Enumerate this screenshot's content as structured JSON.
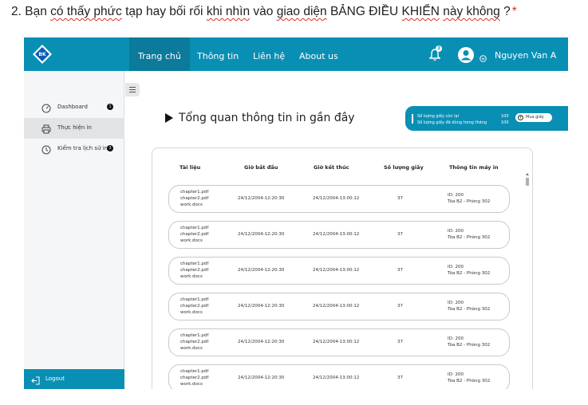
{
  "question": {
    "number": "2.",
    "text_a": "Bạn",
    "text_b": "có thấy phức",
    "text_c": "tạp hay bối rối",
    "text_d": "khi nhìn",
    "text_e": "vào",
    "text_f": "giao diện",
    "text_g": "BẢNG ĐIỀU",
    "text_h": "KHIỂN",
    "text_i": "này không",
    "text_j": "?",
    "required": "*"
  },
  "topbar": {
    "logo_text": "BK",
    "nav": [
      "Trang chủ",
      "Thông tin",
      "Liên hệ",
      "About us"
    ],
    "notification_count": "3",
    "username": "Nguyen Van A"
  },
  "sidebar": {
    "items": [
      {
        "label": "Dashboard",
        "count": "1"
      },
      {
        "label": "Thực hiện in",
        "count": ""
      },
      {
        "label": "Kiểm tra lịch sử in",
        "count": "3"
      }
    ],
    "logout": "Logout"
  },
  "overview": {
    "title": "Tổng quan thông tin in gần đây"
  },
  "paper": {
    "remaining_label": "Số lượng giấy còn lại",
    "remaining_value": "100",
    "used_label": "Số lượng giấy đã dùng trong tháng",
    "used_value": "100",
    "buy_label": "Mua giấy"
  },
  "table": {
    "headers": [
      "Tài liệu",
      "Giờ bắt đầu",
      "Giờ kết thúc",
      "Số lượng giấy",
      "Thông tin máy in"
    ],
    "rows": [
      {
        "file1": "chapter1.pdf",
        "file2": "chapter2.pdf",
        "file3": "work.docs",
        "start": "24/12/2004-12:20:30",
        "end": "24/12/2004-13:00:12",
        "pages": "37",
        "id": "ID: 200",
        "room": "Tòa B2 - Phòng 302"
      },
      {
        "file1": "chapter1.pdf",
        "file2": "chapter2.pdf",
        "file3": "work.docs",
        "start": "24/12/2004-12:20:30",
        "end": "24/12/2004-13:00:12",
        "pages": "37",
        "id": "ID: 200",
        "room": "Tòa B2 - Phòng 302"
      },
      {
        "file1": "chapter1.pdf",
        "file2": "chapter2.pdf",
        "file3": "work.docs",
        "start": "24/12/2004-12:20:30",
        "end": "24/12/2004-13:00:12",
        "pages": "37",
        "id": "ID: 200",
        "room": "Tòa B2 - Phòng 302"
      },
      {
        "file1": "chapter1.pdf",
        "file2": "chapter2.pdf",
        "file3": "work.docs",
        "start": "24/12/2004-12:20:30",
        "end": "24/12/2004-13:00:12",
        "pages": "37",
        "id": "ID: 200",
        "room": "Tòa B2 - Phòng 302"
      },
      {
        "file1": "chapter1.pdf",
        "file2": "chapter2.pdf",
        "file3": "work.docs",
        "start": "24/12/2004-12:20:30",
        "end": "24/12/2004-13:00:12",
        "pages": "37",
        "id": "ID: 200",
        "room": "Tòa B2 - Phòng 302"
      },
      {
        "file1": "chapter1.pdf",
        "file2": "chapter2.pdf",
        "file3": "work.docs",
        "start": "24/12/2004-12:20:30",
        "end": "24/12/2004-13:00:12",
        "pages": "37",
        "id": "ID: 200",
        "room": "Tòa B2 - Phòng 302"
      }
    ]
  },
  "colors": {
    "primary": "#0a8fb4",
    "nav_active": "#0b7a9b",
    "required": "#d93025"
  }
}
